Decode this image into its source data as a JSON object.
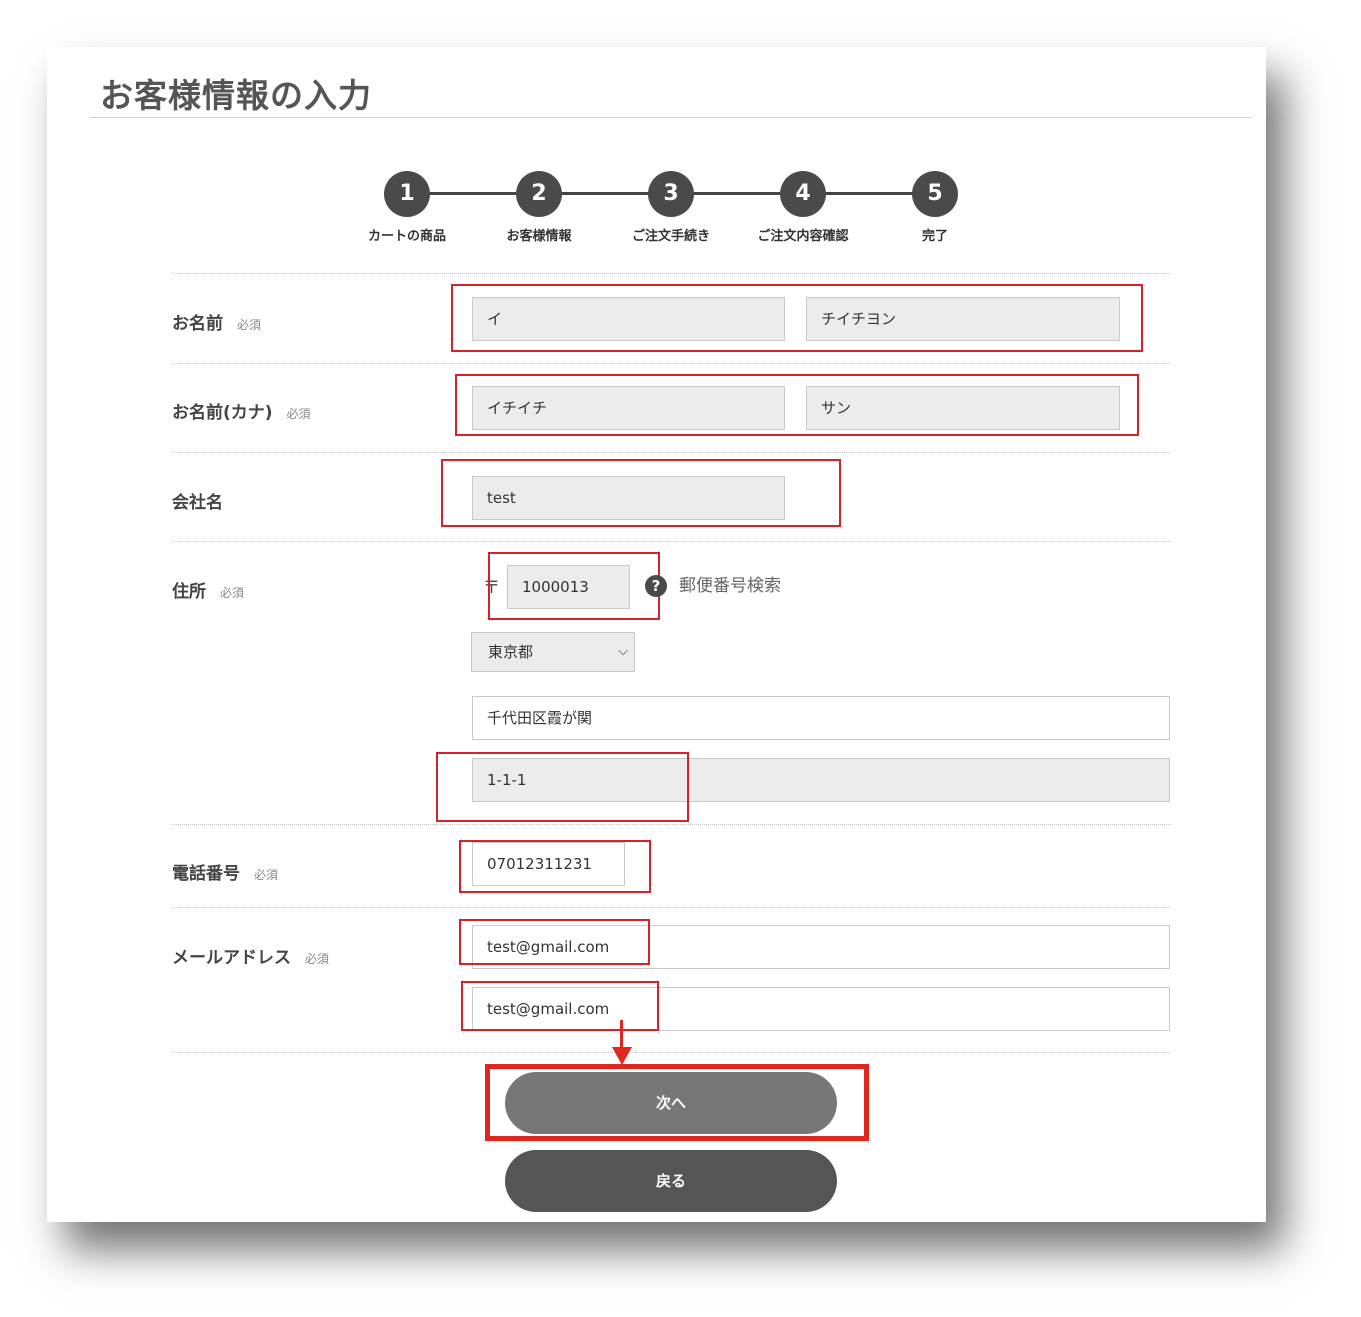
{
  "page_title": "お客様情報の入力",
  "steps": [
    {
      "number": "1",
      "label": "カートの商品"
    },
    {
      "number": "2",
      "label": "お客様情報"
    },
    {
      "number": "3",
      "label": "ご注文手続き"
    },
    {
      "number": "4",
      "label": "ご注文内容確認"
    },
    {
      "number": "5",
      "label": "完了"
    }
  ],
  "required_text": "必須",
  "form": {
    "name": {
      "label": "お名前",
      "last": "イ",
      "first": "チイチヨン"
    },
    "name_kana": {
      "label": "お名前(カナ)",
      "last": "イチイチ",
      "first": "サン"
    },
    "company": {
      "label": "会社名",
      "value": "test"
    },
    "address": {
      "label": "住所",
      "postal_mark": "〒",
      "postal_code": "1000013",
      "help_icon": "?",
      "postal_search": "郵便番号検索",
      "prefecture": "東京都",
      "city": "千代田区霞が関",
      "street": "1-1-1"
    },
    "phone": {
      "label": "電話番号",
      "value": "07012311231"
    },
    "email": {
      "label": "メールアドレス",
      "value": "test@gmail.com",
      "confirm": "test@gmail.com"
    }
  },
  "buttons": {
    "next": "次へ",
    "back": "戻る"
  },
  "colors": {
    "highlight": "#d2232a",
    "step_circle": "#4a4a4a"
  }
}
